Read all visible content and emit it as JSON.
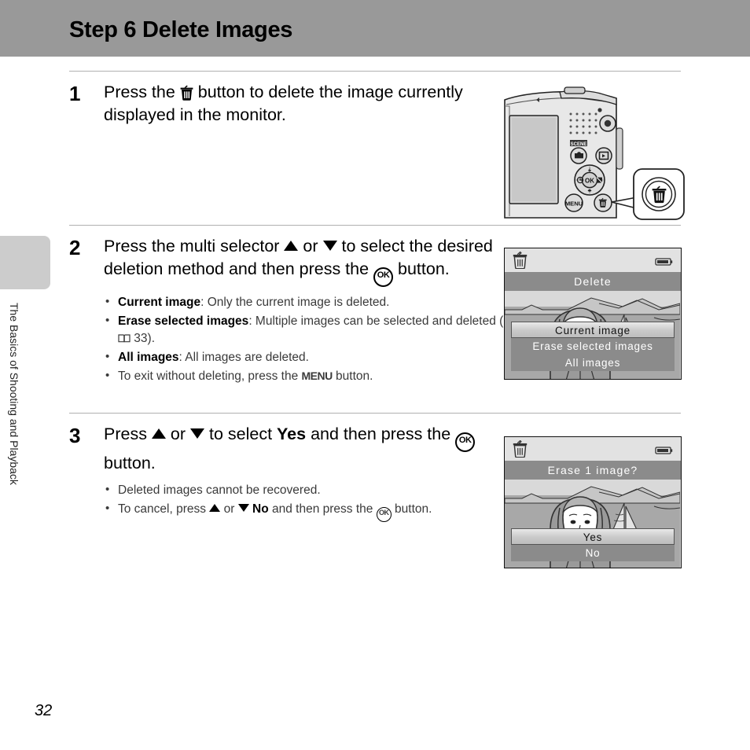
{
  "page": {
    "title": "Step 6 Delete Images",
    "number": "32",
    "side_tab_label": "The Basics of Shooting and Playback"
  },
  "steps": [
    {
      "number": "1",
      "lead_parts": {
        "before": "Press the ",
        "icon": "trash-icon",
        "after": " button to delete the image currently displayed in the monitor."
      },
      "bullets": []
    },
    {
      "number": "2",
      "lead_parts": {
        "before": "Press the multi selector ",
        "icon": "up-triangle-icon",
        "mid": " or ",
        "icon2": "down-triangle-icon",
        "mid2": " to select the desired deletion method and then press the ",
        "icon3": "ok-button-icon",
        "after": " button."
      },
      "bullets": [
        {
          "bold": "Current image",
          "text": ": Only the current image is deleted."
        },
        {
          "bold": "Erase selected images",
          "text": ": Multiple images can be selected and deleted (",
          "ref_icon": "book-icon",
          "ref": " 33)."
        },
        {
          "bold": "All images",
          "text": ": All images are deleted."
        },
        {
          "bold": "",
          "text_before": "To exit without deleting, press the ",
          "menu_label": "MENU",
          "text_after": " button."
        }
      ]
    },
    {
      "number": "3",
      "lead_parts": {
        "before": "Press ",
        "icon": "up-triangle-icon",
        "mid": " or ",
        "icon2": "down-triangle-icon",
        "mid2": " to select ",
        "bold": "Yes",
        "mid3": " and then press the ",
        "icon3": "ok-button-icon",
        "after": " button."
      },
      "bullets": [
        {
          "text": "Deleted images cannot be recovered."
        },
        {
          "text_before": "To cancel, press ",
          "text_mid": " or ",
          "bold": "No",
          "text_mid2": " and then press the ",
          "text_after": " button."
        }
      ]
    }
  ],
  "figures": {
    "camera": {
      "name": "camera-back-illustration",
      "callout_icon": "trash-button-icon",
      "labels": {
        "scene": "SCENE",
        "menu": "MENU",
        "ok": "OK"
      }
    },
    "delete_menu_screen": {
      "title": "Delete",
      "status_left_icon": "trash-icon",
      "status_right_icon": "battery-icon",
      "items": [
        {
          "label": "Current image",
          "selected": true
        },
        {
          "label": "Erase selected images",
          "selected": false
        },
        {
          "label": "All images",
          "selected": false
        }
      ]
    },
    "confirm_screen": {
      "title": "Erase 1 image?",
      "status_left_icon": "trash-icon",
      "status_right_icon": "battery-icon",
      "items": [
        {
          "label": "Yes",
          "selected": true
        },
        {
          "label": "No",
          "selected": false
        }
      ]
    }
  },
  "colors": {
    "header_band": "#999999",
    "side_tab": "#cccccc",
    "lcd_titlebar": "#8b8b8b",
    "divider": "#b0b0b0"
  }
}
